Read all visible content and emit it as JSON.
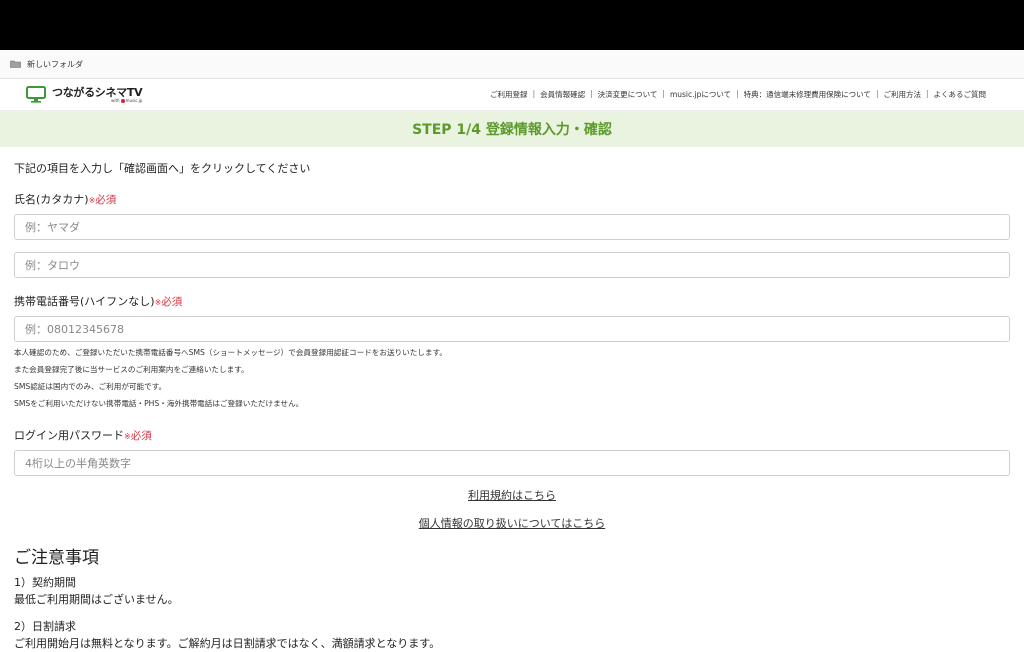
{
  "bookmarks": {
    "folder_label": "新しいフォルダ"
  },
  "header": {
    "logo_name": "つながるシネマTV",
    "logo_sub_left": "with",
    "logo_sub_right": "music.jp",
    "nav": [
      "ご利用登録",
      "会員情報確認",
      "決済変更について",
      "music.jpについて",
      "特典：通信端末修理費用保険について",
      "ご利用方法",
      "よくあるご質問"
    ],
    "separator": "|"
  },
  "step": {
    "title": "STEP 1/4 登録情報入力・確認"
  },
  "form": {
    "intro": "下記の項目を入力し「確認画面へ」をクリックしてください",
    "required_mark": "※",
    "required_text": "必須",
    "name_label": "氏名(カタカナ)",
    "last_name_placeholder": "例：ヤマダ",
    "first_name_placeholder": "例：タロウ",
    "phone_label": "携帯電話番号(ハイフンなし)",
    "phone_placeholder": "例：08012345678",
    "phone_notes": [
      "本人確認のため、ご登録いただいた携帯電話番号へSMS（ショートメッセージ）で会員登録用認証コードをお送りいたします。",
      "また会員登録完了後に当サービスのご利用案内をご連絡いたします。",
      "SMS認証は国内でのみ、ご利用が可能です。",
      "SMSをご利用いただけない携帯電話・PHS・海外携帯電話はご登録いただけません。"
    ],
    "password_label": "ログイン用パスワード",
    "password_placeholder": "4桁以上の半角英数字"
  },
  "links": {
    "terms": "利用規約はこちら",
    "privacy": "個人情報の取り扱いについてはこちら"
  },
  "notices": {
    "title": "ご注意事項",
    "item1_title": "1）契約期間",
    "item1_text": "最低ご利用期間はございません。",
    "item2_title": "2）日割請求",
    "item2_text": "ご利用開始月は無料となります。ご解約月は日割請求ではなく、満額請求となります。"
  },
  "colors": {
    "accent_green": "#5d9a2c",
    "banner_bg": "#e9f3e0",
    "required_red": "#d8333f"
  }
}
